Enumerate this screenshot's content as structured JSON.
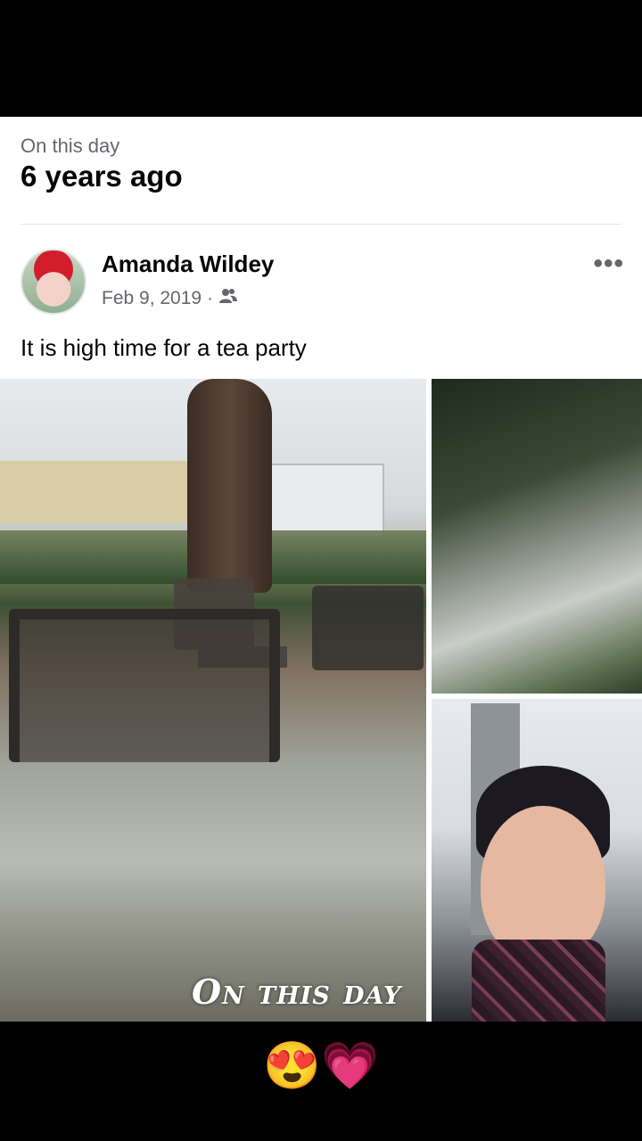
{
  "memory": {
    "label": "On this day",
    "title": "6 years ago"
  },
  "post": {
    "author": "Amanda Wildey",
    "date": "Feb 9, 2019",
    "separator": "·",
    "audience_icon": "friends-icon",
    "more_label": "•••",
    "caption": "It is high time for a tea party"
  },
  "overlay": {
    "text": "On this day"
  },
  "reactions": {
    "text": "😍💗"
  }
}
